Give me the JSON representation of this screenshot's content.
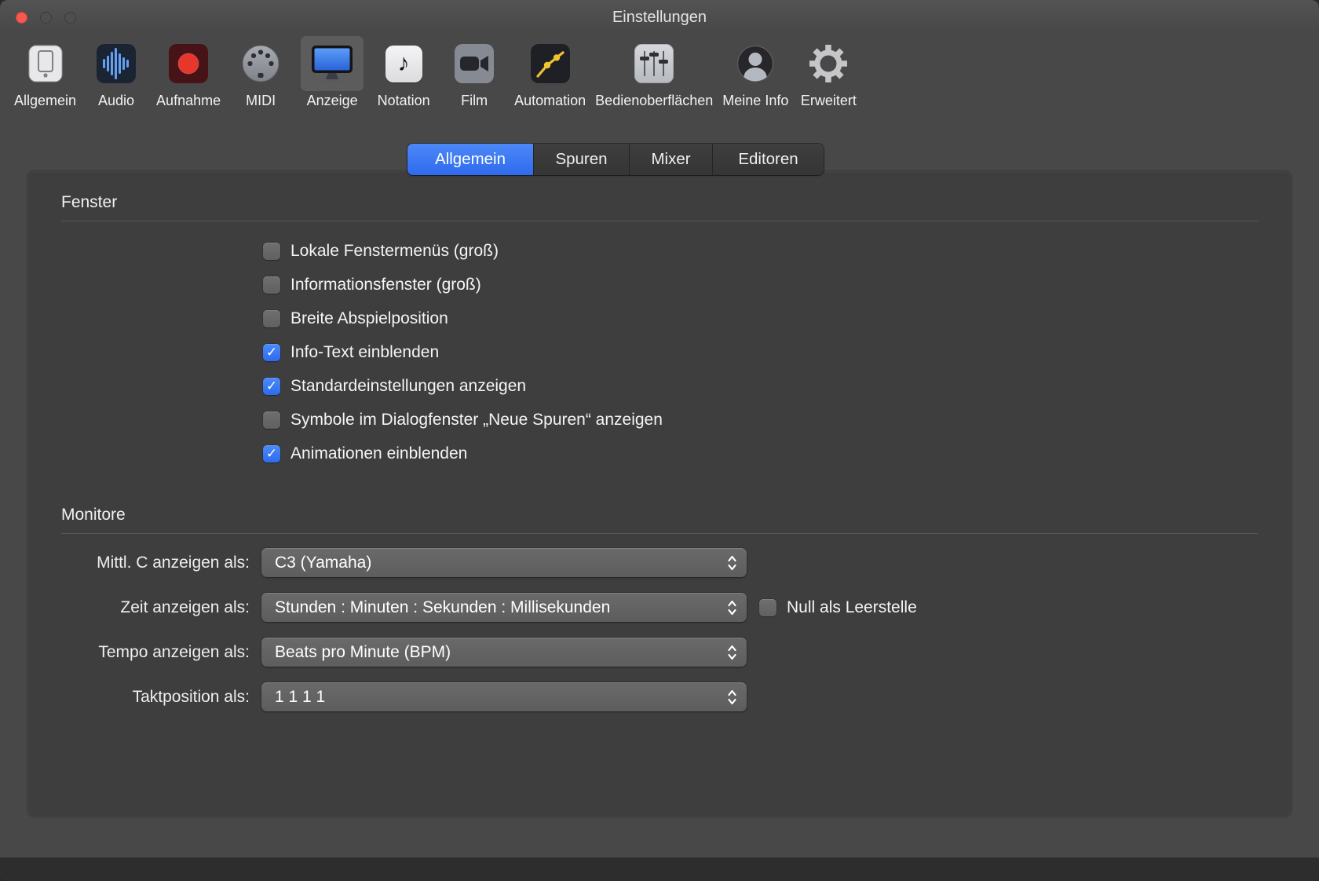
{
  "window": {
    "title": "Einstellungen"
  },
  "toolbar": {
    "items": [
      {
        "label": "Allgemein",
        "icon": "device-icon",
        "selected": false
      },
      {
        "label": "Audio",
        "icon": "audio-waveform-icon",
        "selected": false
      },
      {
        "label": "Aufnahme",
        "icon": "record-icon",
        "selected": false
      },
      {
        "label": "MIDI",
        "icon": "midi-connector-icon",
        "selected": false
      },
      {
        "label": "Anzeige",
        "icon": "display-icon",
        "selected": true
      },
      {
        "label": "Notation",
        "icon": "music-note-icon",
        "glyph": "♪",
        "selected": false
      },
      {
        "label": "Film",
        "icon": "video-camera-icon",
        "selected": false
      },
      {
        "label": "Automation",
        "icon": "automation-curve-icon",
        "selected": false
      },
      {
        "label": "Bedienoberflächen",
        "icon": "faders-icon",
        "selected": false
      },
      {
        "label": "Meine Info",
        "icon": "user-icon",
        "selected": false
      },
      {
        "label": "Erweitert",
        "icon": "gear-icon",
        "selected": false
      }
    ]
  },
  "tabs": [
    {
      "label": "Allgemein",
      "selected": true
    },
    {
      "label": "Spuren",
      "selected": false
    },
    {
      "label": "Mixer",
      "selected": false
    },
    {
      "label": "Editoren",
      "selected": false
    }
  ],
  "sections": {
    "fenster": {
      "title": "Fenster",
      "checkboxes": [
        {
          "label": "Lokale Fenstermenüs (groß)",
          "checked": false
        },
        {
          "label": "Informationsfenster (groß)",
          "checked": false
        },
        {
          "label": "Breite Abspielposition",
          "checked": false
        },
        {
          "label": "Info-Text einblenden",
          "checked": true
        },
        {
          "label": "Standardeinstellungen anzeigen",
          "checked": true
        },
        {
          "label": "Symbole im Dialogfenster „Neue Spuren“ anzeigen",
          "checked": false
        },
        {
          "label": "Animationen einblenden",
          "checked": true
        }
      ]
    },
    "monitore": {
      "title": "Monitore",
      "rows": [
        {
          "label": "Mittl. C anzeigen als:",
          "value": "C3 (Yamaha)"
        },
        {
          "label": "Zeit anzeigen als:",
          "value": "Stunden : Minuten : Sekunden : Millisekunden"
        },
        {
          "label": "Tempo anzeigen als:",
          "value": "Beats pro Minute (BPM)"
        },
        {
          "label": "Taktposition als:",
          "value": "1 1 1 1"
        }
      ],
      "zero_checkbox": {
        "label": "Null als Leerstelle",
        "checked": false
      }
    }
  },
  "colors": {
    "accent_blue": "#3a76f2",
    "checkbox_blue": "#3d7bf5",
    "record_red": "#e7362c",
    "automation_yellow": "#f0c42e",
    "display_blue": "#3f86f2",
    "panel_bg": "#3e3e3e",
    "window_bg": "#484848"
  }
}
